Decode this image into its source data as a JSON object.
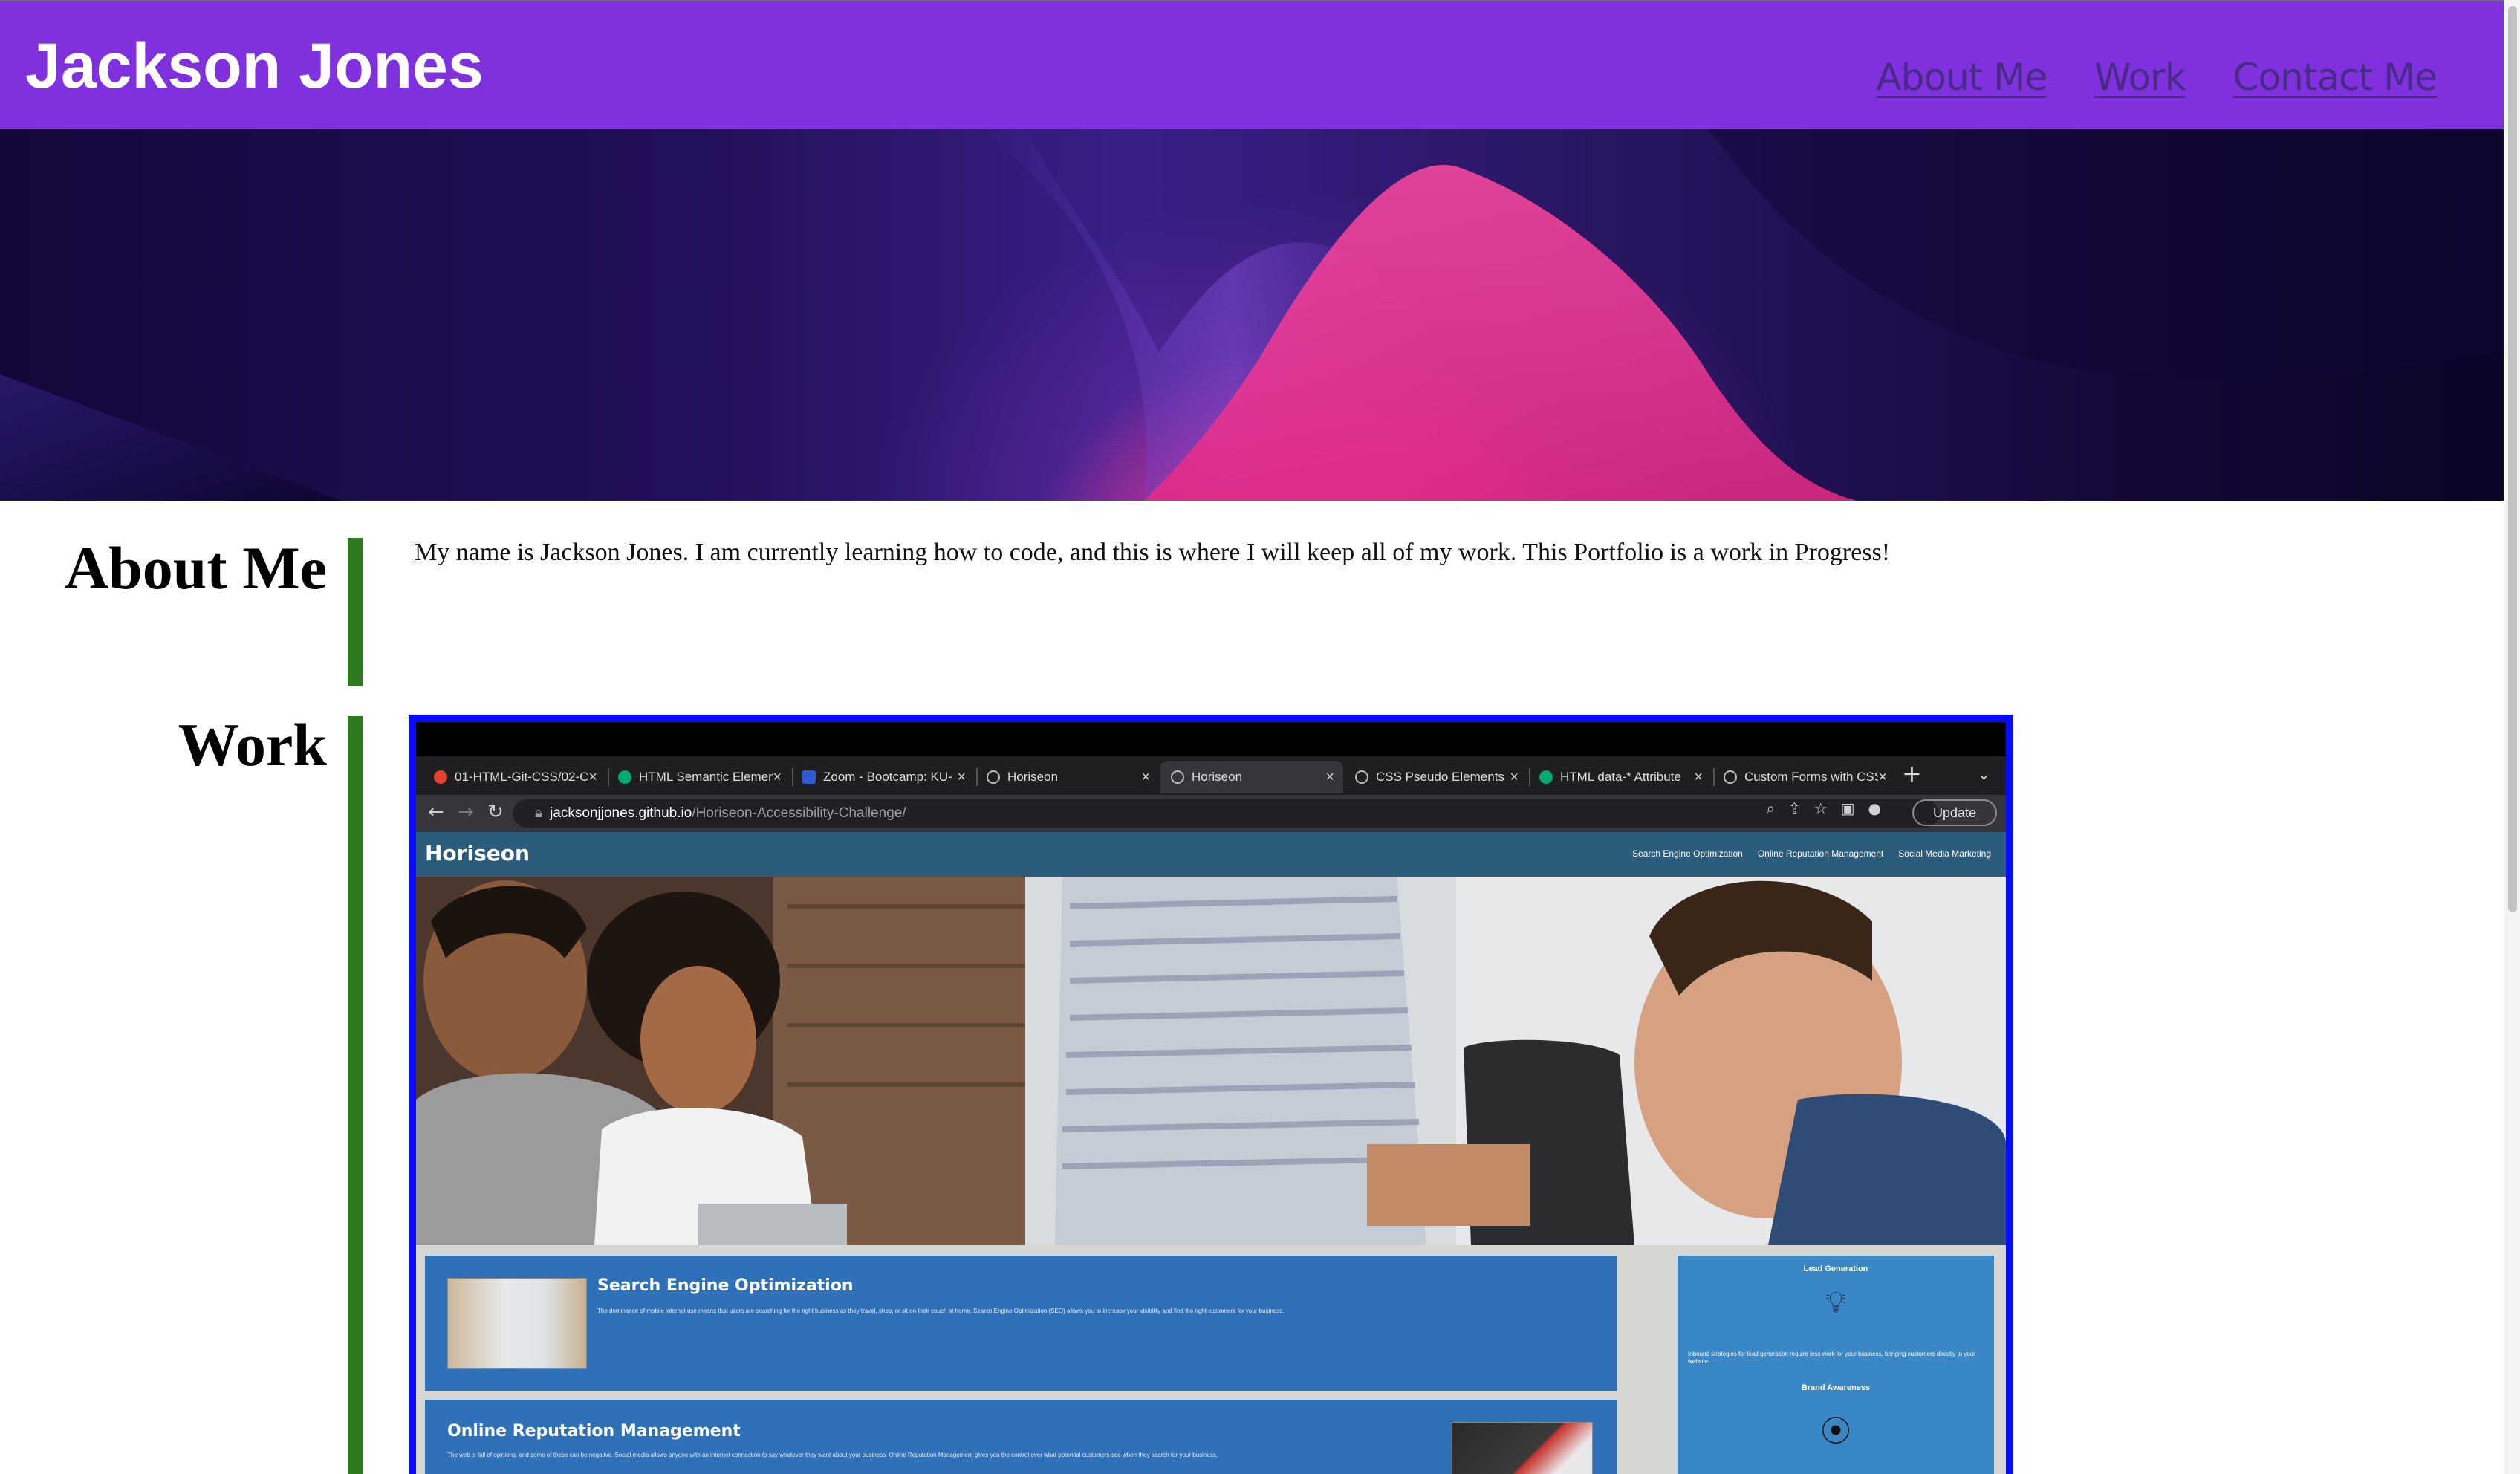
{
  "header": {
    "site_title": "Jackson Jones",
    "nav": [
      {
        "label": "About Me"
      },
      {
        "label": "Work"
      },
      {
        "label": "Contact Me"
      }
    ]
  },
  "about": {
    "heading": "About Me",
    "text": "My name is Jackson Jones. I am currently learning how to code, and this is where I will keep all of my work. This Portfolio is a work in Progress!"
  },
  "work": {
    "heading": "Work",
    "screenshot": {
      "tabs": [
        {
          "title": "01-HTML-Git-CSS/02-C",
          "icon": "gitlab-icon"
        },
        {
          "title": "HTML Semantic Elemen",
          "icon": "w3schools-icon"
        },
        {
          "title": "Zoom - Bootcamp: KU-",
          "icon": "ku-icon"
        },
        {
          "title": "Horiseon",
          "icon": "globe-icon"
        },
        {
          "title": "Horiseon",
          "icon": "globe-icon",
          "active": true
        },
        {
          "title": "CSS Pseudo Elements",
          "icon": "globe-icon"
        },
        {
          "title": "HTML data-* Attribute",
          "icon": "w3schools-icon"
        },
        {
          "title": "Custom Forms with CSS",
          "icon": "globe-icon"
        }
      ],
      "url_host": "jacksonjjones.github.io",
      "url_path": "/Horiseon-Accessibility-Challenge/",
      "update_label": "Update",
      "site": {
        "logo": "Horiseon",
        "nav": [
          "Search Engine Optimization",
          "Online Reputation Management",
          "Social Media Marketing"
        ],
        "services": [
          {
            "title": "Search Engine Optimization",
            "text": "The dominance of mobile internet use means that users are searching for the right business as they travel, shop, or sit on their couch at home. Search Engine Optimization (SEO) allows you to increase your visibility and find the right customers for your business."
          },
          {
            "title": "Online Reputation Management",
            "text": "The web is full of opinions, and some of these can be negative. Social media allows anyone with an internet connection to say whatever they want about your business. Online Reputation Management gives you the control over what potential customers see when they search for your business."
          }
        ],
        "benefits": [
          {
            "title": "Lead Generation",
            "text": "Inbound strategies for lead generation require less work for your business, bringing customers directly to your website."
          },
          {
            "title": "Brand Awareness"
          }
        ]
      }
    }
  },
  "colors": {
    "header_bg": "#7e31dd",
    "nav_link": "#4a2a87",
    "section_bar": "#2f7a1f",
    "work_border": "#0a0aff"
  }
}
